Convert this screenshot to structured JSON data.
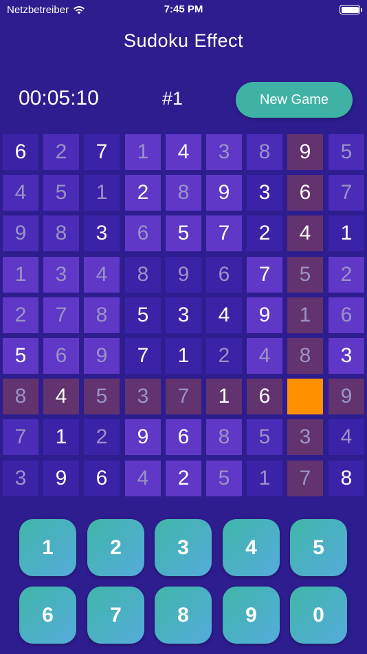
{
  "status_bar": {
    "carrier": "Netzbetreiber",
    "time": "7:45 PM"
  },
  "header": {
    "title": "Sudoku Effect"
  },
  "game": {
    "timer": "00:05:10",
    "number": "#1",
    "new_game_label": "New Game"
  },
  "colors": {
    "background": "#2e1d8f",
    "cell_dark": "#3b23a8",
    "cell_mid": "#4a2cb8",
    "cell_light": "#5f38c8",
    "cell_highlight": "#62336e",
    "cell_selected": "#ff9100",
    "button_teal": "#3fb2a6"
  },
  "board": {
    "selected": [
      6,
      7
    ],
    "rows": [
      [
        "6",
        "2",
        "7",
        "1",
        "4",
        "3",
        "8",
        "9",
        "5"
      ],
      [
        "4",
        "5",
        "1",
        "2",
        "8",
        "9",
        "3",
        "6",
        "7"
      ],
      [
        "9",
        "8",
        "3",
        "6",
        "5",
        "7",
        "2",
        "4",
        "1"
      ],
      [
        "1",
        "3",
        "4",
        "8",
        "9",
        "6",
        "7",
        "5",
        "2"
      ],
      [
        "2",
        "7",
        "8",
        "5",
        "3",
        "4",
        "9",
        "1",
        "6"
      ],
      [
        "5",
        "6",
        "9",
        "7",
        "1",
        "2",
        "4",
        "8",
        "3"
      ],
      [
        "8",
        "4",
        "5",
        "3",
        "7",
        "1",
        "6",
        "",
        "9"
      ],
      [
        "7",
        "1",
        "2",
        "9",
        "6",
        "8",
        "5",
        "3",
        "4"
      ],
      [
        "3",
        "9",
        "6",
        "4",
        "2",
        "5",
        "1",
        "7",
        "8"
      ]
    ],
    "fixed": [
      [
        1,
        0,
        1,
        0,
        1,
        0,
        0,
        1,
        0
      ],
      [
        0,
        0,
        0,
        1,
        0,
        1,
        1,
        1,
        0
      ],
      [
        0,
        0,
        1,
        0,
        1,
        1,
        1,
        1,
        1
      ],
      [
        0,
        0,
        0,
        0,
        0,
        0,
        1,
        0,
        0
      ],
      [
        0,
        0,
        0,
        1,
        1,
        1,
        1,
        0,
        0
      ],
      [
        1,
        0,
        0,
        1,
        1,
        0,
        0,
        0,
        1
      ],
      [
        0,
        1,
        0,
        0,
        0,
        1,
        1,
        0,
        0
      ],
      [
        0,
        1,
        0,
        1,
        1,
        0,
        0,
        0,
        0
      ],
      [
        0,
        1,
        1,
        0,
        1,
        0,
        0,
        0,
        1
      ]
    ],
    "shade": [
      [
        "a",
        "b",
        "a",
        "c",
        "c",
        "c",
        "b",
        "h",
        "b"
      ],
      [
        "b",
        "b",
        "a",
        "c",
        "c",
        "c",
        "a",
        "h",
        "b"
      ],
      [
        "b",
        "b",
        "a",
        "c",
        "c",
        "c",
        "a",
        "h",
        "a"
      ],
      [
        "c",
        "c",
        "c",
        "a",
        "a",
        "a",
        "c",
        "h",
        "c"
      ],
      [
        "c",
        "c",
        "c",
        "a",
        "a",
        "a",
        "c",
        "h",
        "c"
      ],
      [
        "c",
        "c",
        "c",
        "a",
        "a",
        "a",
        "c",
        "h",
        "c"
      ],
      [
        "h",
        "h",
        "h",
        "h",
        "h",
        "h",
        "h",
        "sel",
        "h"
      ],
      [
        "b",
        "a",
        "a",
        "c",
        "c",
        "c",
        "b",
        "h",
        "a"
      ],
      [
        "a",
        "a",
        "a",
        "c",
        "c",
        "c",
        "a",
        "h",
        "a"
      ]
    ]
  },
  "keypad": [
    "1",
    "2",
    "3",
    "4",
    "5",
    "6",
    "7",
    "8",
    "9",
    "0"
  ]
}
